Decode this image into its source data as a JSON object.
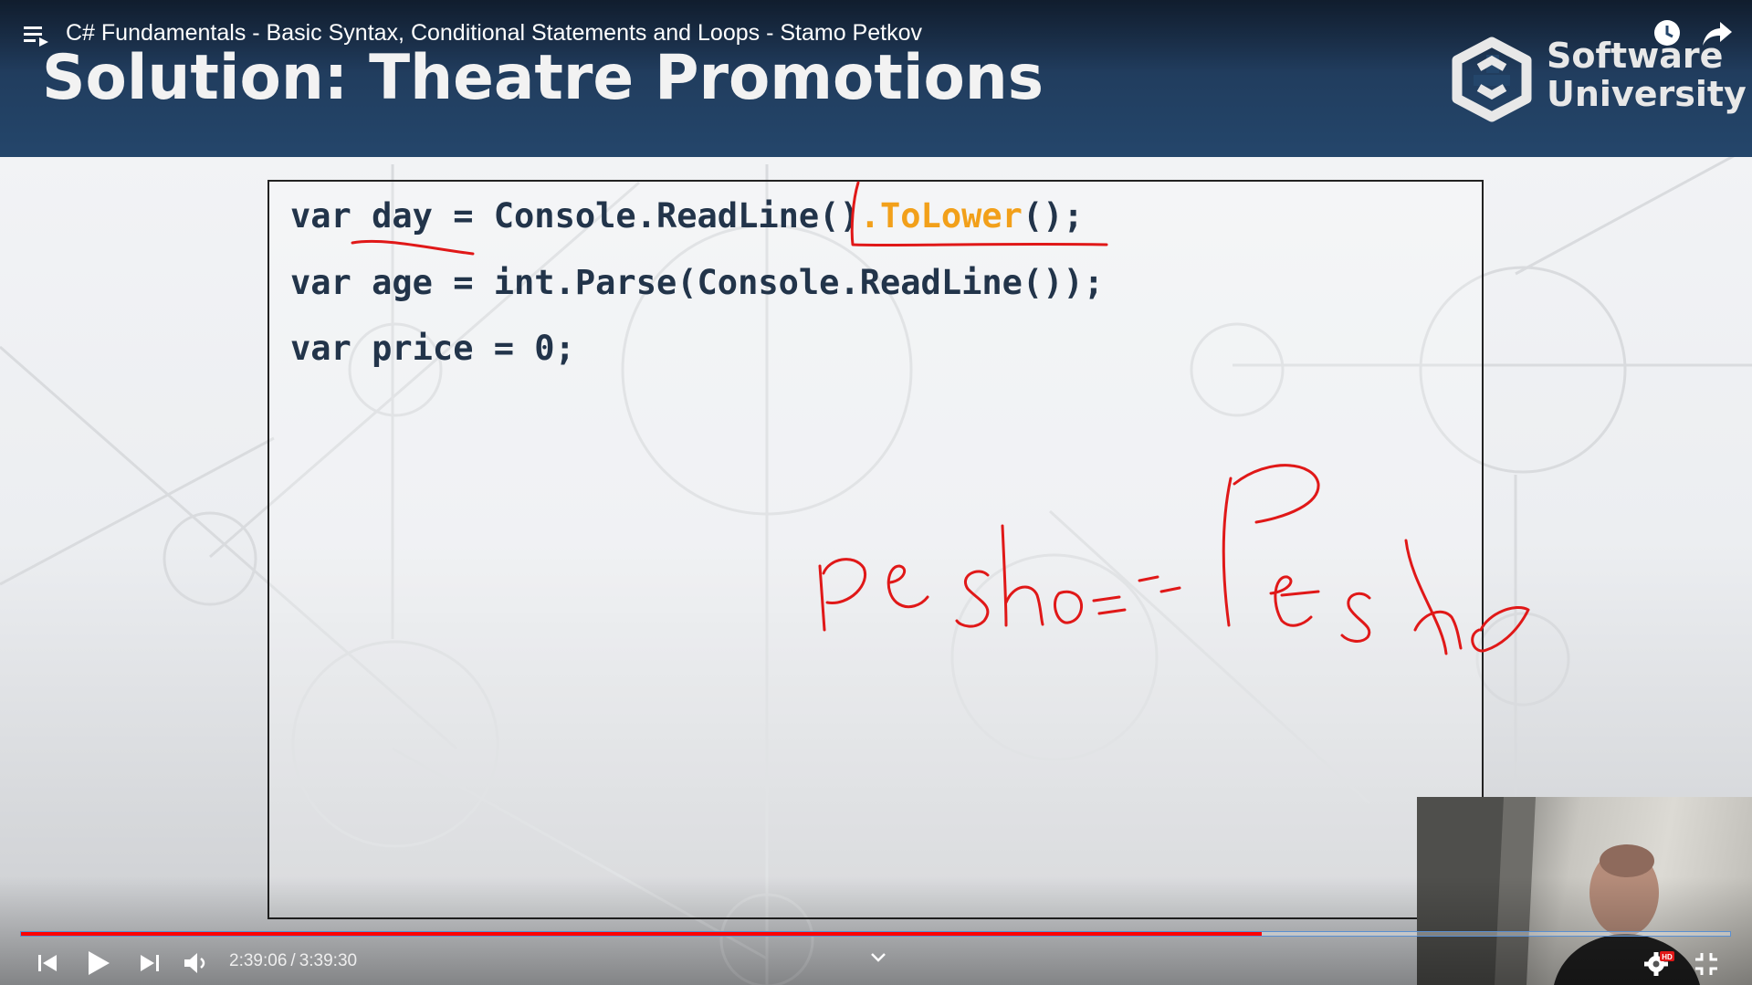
{
  "player": {
    "video_title": "C# Fundamentals - Basic Syntax, Conditional Statements and Loops - Stamo Petkov",
    "time_current": "2:39:06",
    "time_separator": "/",
    "time_total": "3:39:30",
    "progress_fraction": 0.7257,
    "accent_color": "#ff0000",
    "settings_badge": "HD",
    "icons": [
      "playlist-icon",
      "watch-later-icon",
      "share-icon",
      "skip-previous-icon",
      "play-icon",
      "skip-next-icon",
      "volume-icon",
      "chevron-down-icon",
      "settings-gear-icon",
      "fullscreen-exit-icon"
    ]
  },
  "slide": {
    "title": "Solution: Theatre Promotions",
    "logo_line1": "Software",
    "logo_line2": "University",
    "header_color": "#24466b",
    "code_lines": [
      {
        "before": "var day = Console.ReadLine()",
        "accent": ".ToLower",
        "after": "();"
      },
      {
        "before": "var age = int.Parse(Console.ReadLine());",
        "accent": "",
        "after": ""
      },
      {
        "before": "var price = 0;",
        "accent": "",
        "after": ""
      }
    ],
    "code_accent_color": "#f2a01a",
    "annotation_text": "pesho==Pesho",
    "annotation_color": "#e01818"
  }
}
